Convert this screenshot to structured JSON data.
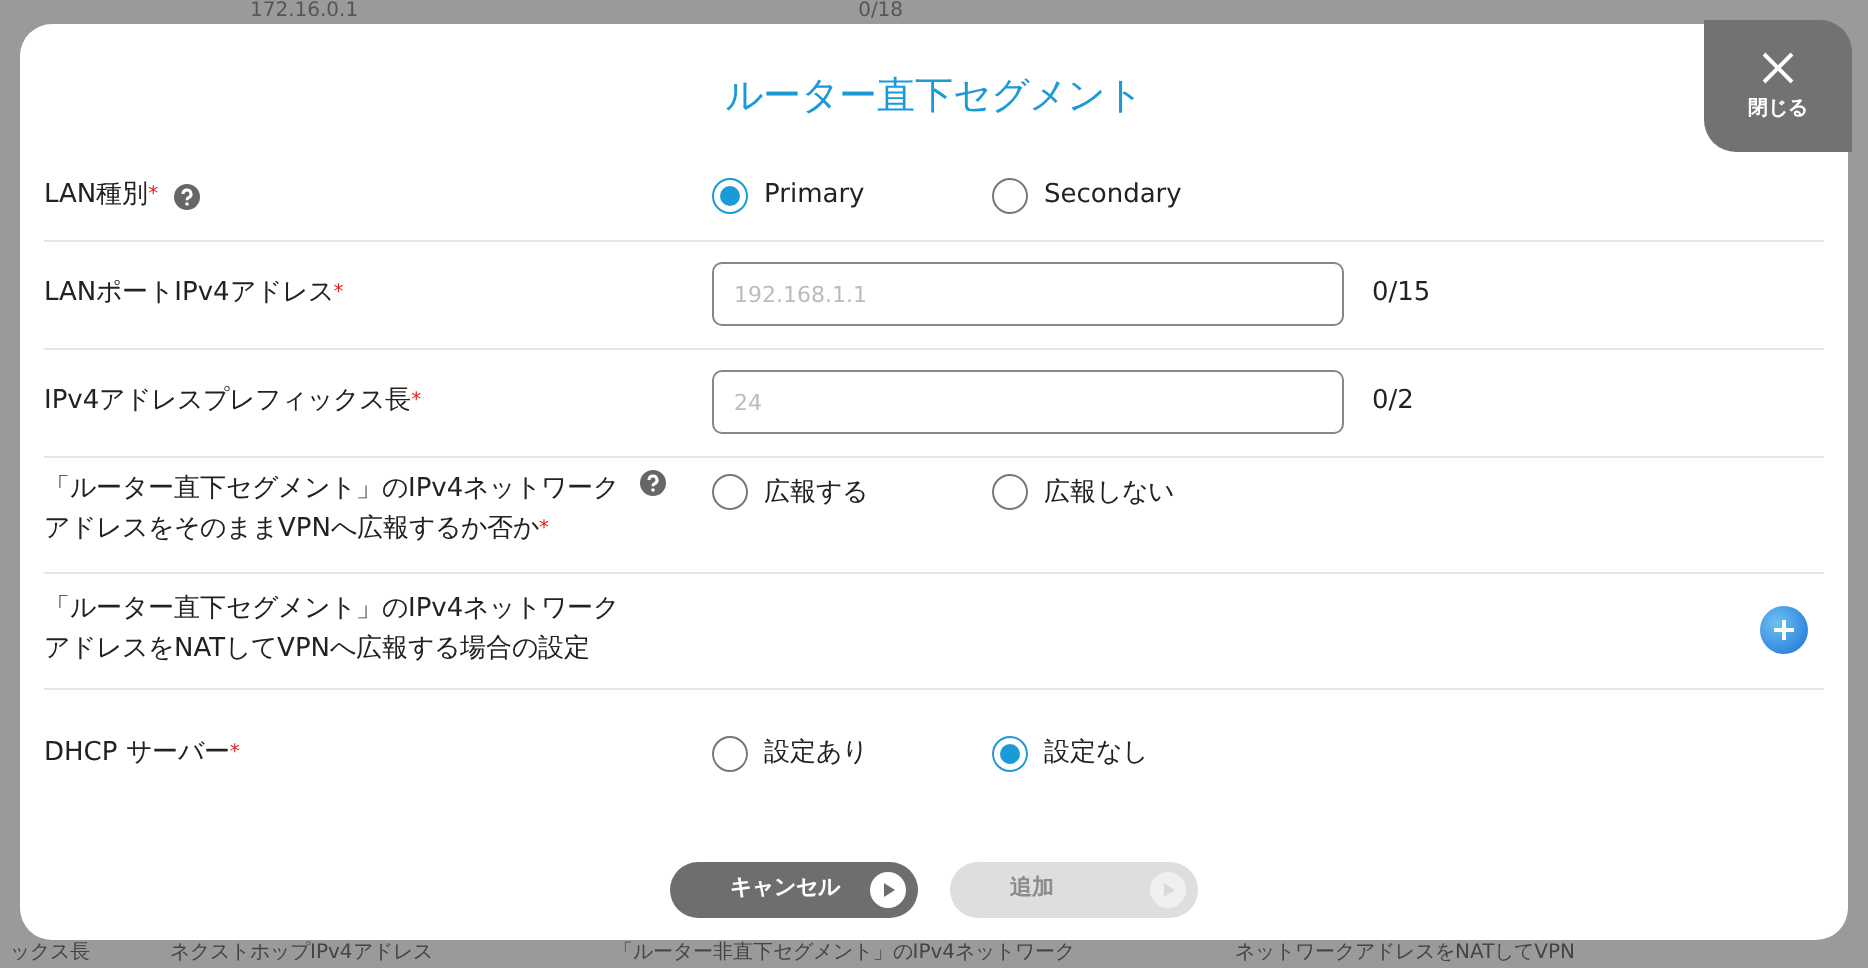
{
  "background_page": {
    "top_cells": [
      "172.16.0.1",
      "0/18"
    ],
    "bottom_cells": [
      "ックス長",
      "ネクストホップIPv4アドレス",
      "「ルーター非直下セグメント」のIPv4ネットワーク",
      "ネットワークアドレスをNATしてVPN"
    ]
  },
  "dialog": {
    "title": "ルーター直下セグメント",
    "close_label": "閉じる",
    "rows": [
      {
        "kind": "radio",
        "label": "LAN種別",
        "required_mark": "*",
        "help": true,
        "options": [
          {
            "label": "Primary",
            "selected": true
          },
          {
            "label": "Secondary",
            "selected": false
          }
        ]
      },
      {
        "kind": "text",
        "label": "LANポートIPv4アドレス",
        "required_mark": "*",
        "help": false,
        "placeholder": "192.168.1.1",
        "counter": "0/15"
      },
      {
        "kind": "text",
        "label": "IPv4アドレスプレフィックス長",
        "required_mark": "*",
        "help": false,
        "placeholder": "24",
        "counter": "0/2"
      },
      {
        "kind": "radio",
        "label": "「ルーター直下セグメント」のIPv4ネットワークアドレスをそのままVPNへ広報するか否か",
        "required_mark": "*",
        "help": true,
        "options": [
          {
            "label": "広報する",
            "selected": false
          },
          {
            "label": "広報しない",
            "selected": false
          }
        ]
      },
      {
        "kind": "add",
        "label": "「ルーター直下セグメント」のIPv4ネットワークアドレスをNATしてVPNへ広報する場合の設定",
        "help": false
      },
      {
        "kind": "radio",
        "label": "DHCP サーバー",
        "required_mark": "*",
        "help": false,
        "options": [
          {
            "label": "設定あり",
            "selected": false
          },
          {
            "label": "設定なし",
            "selected": true
          }
        ]
      }
    ],
    "buttons": [
      {
        "label": "キャンセル",
        "disabled": false
      },
      {
        "label": "追加",
        "disabled": true
      }
    ]
  }
}
